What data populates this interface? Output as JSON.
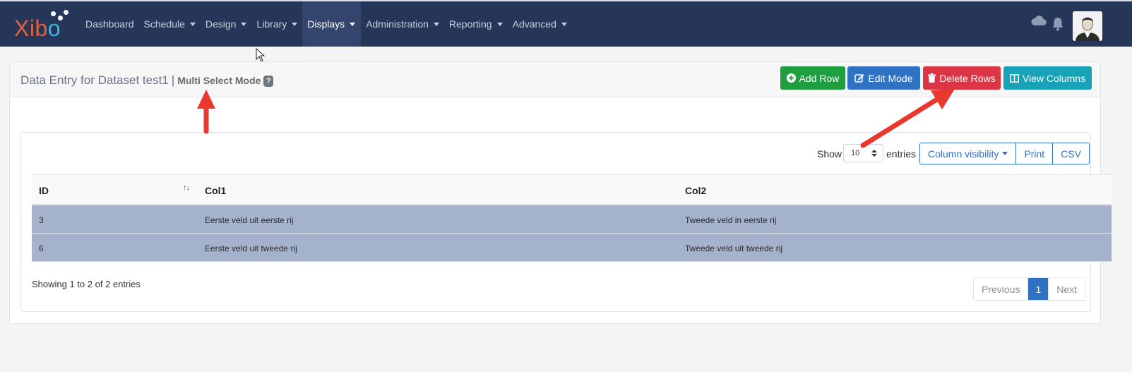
{
  "app": {
    "logo_text_x": "Xib",
    "logo_text_o": "o"
  },
  "nav": {
    "items": [
      {
        "label": "Dashboard",
        "dropdown": false,
        "active": false
      },
      {
        "label": "Schedule",
        "dropdown": true,
        "active": false
      },
      {
        "label": "Design",
        "dropdown": true,
        "active": false
      },
      {
        "label": "Library",
        "dropdown": true,
        "active": false
      },
      {
        "label": "Displays",
        "dropdown": true,
        "active": true
      },
      {
        "label": "Administration",
        "dropdown": true,
        "active": false
      },
      {
        "label": "Reporting",
        "dropdown": true,
        "active": false
      },
      {
        "label": "Advanced",
        "dropdown": true,
        "active": false
      }
    ],
    "icons": [
      "cloud-icon",
      "bell-icon",
      "avatar"
    ]
  },
  "page": {
    "title": "Data Entry for Dataset test1",
    "separator": "|",
    "mode": "Multi Select Mode",
    "help": "?",
    "buttons": {
      "add_row": "Add Row",
      "edit_mode": "Edit Mode",
      "delete_rows": "Delete Rows",
      "view_columns": "View Columns"
    }
  },
  "table_controls": {
    "show_label": "Show",
    "page_length": "10",
    "entries_label": "entries",
    "column_visibility": "Column visibility",
    "print": "Print",
    "csv": "CSV"
  },
  "table": {
    "headers": [
      "ID",
      "Col1",
      "Col2"
    ],
    "rows": [
      {
        "id": "3",
        "col1": "Eerste veld uit eerste rij",
        "col2": "Tweede veld in eerste rij",
        "selected": true
      },
      {
        "id": "6",
        "col1": "Eerste veld uit tweede rij",
        "col2": "Tweede veld uit tweede rij",
        "selected": true
      }
    ]
  },
  "footer": {
    "info": "Showing 1 to 2 of 2 entries",
    "pagination": {
      "previous": "Previous",
      "current": "1",
      "next": "Next"
    }
  },
  "colors": {
    "navbar": "#263658",
    "selected_row": "#a4b2cc",
    "add": "#1e9e3e",
    "edit": "#2f72c4",
    "delete": "#dc3545",
    "view_columns": "#17a2b8",
    "annotation_arrow": "#e8392f"
  }
}
